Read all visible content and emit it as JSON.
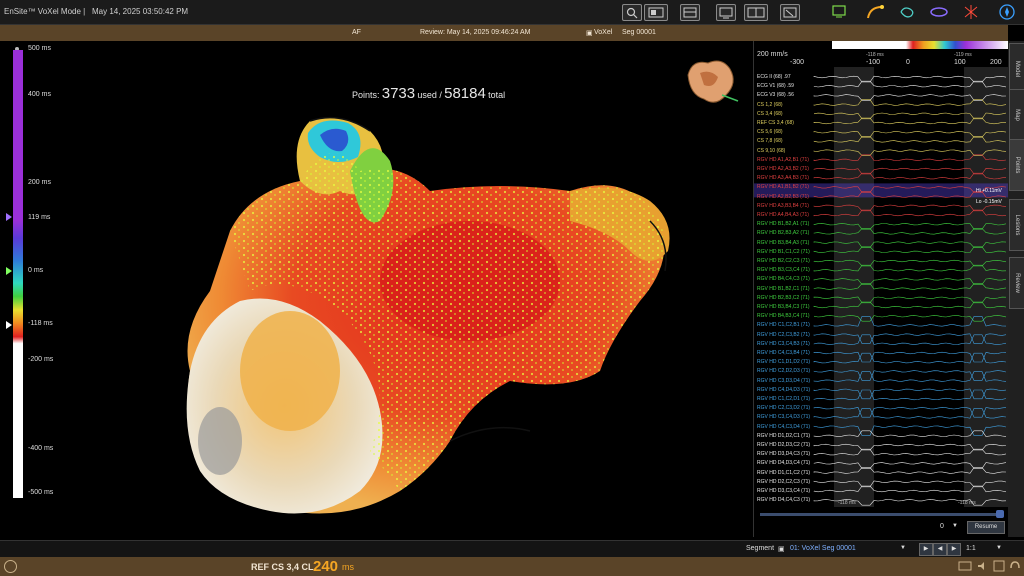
{
  "titlebar": {
    "app_title": "EnSite™ VoXel Mode |",
    "datetime": "May 14, 2025 03:50:42 PM"
  },
  "infobar": {
    "rhythm": "AF",
    "review": "Review: May 14, 2025 09:46:24 AM",
    "mode": "VoXel",
    "segment": "Seg 00001"
  },
  "map": {
    "points_label": "Points:",
    "points_used": "3733",
    "used_label": "used /",
    "points_total": "58184",
    "total_label": "total"
  },
  "scale": {
    "ticks": [
      "500 ms",
      "400 ms",
      "200 ms",
      "119 ms",
      "0 ms",
      "-118 ms",
      "-200 ms",
      "-400 ms",
      "-500 ms"
    ]
  },
  "egm": {
    "sweep": "200 mm/s",
    "time_ticks": [
      "-300",
      "-100",
      "0",
      "100",
      "200"
    ],
    "marker_a": "-118 ms",
    "marker_b": "-119 ms",
    "value_hi": "Hi +0.11mV",
    "value_lo": "Lo -0.15mV",
    "page_value": "0",
    "resume_label": "Resume",
    "foot_a": "-118 ms",
    "foot_b": "-118 ms",
    "channels": [
      "ECG II (68) .97",
      "ECG V1 (68) .59",
      "ECG V3 (68) .56",
      "CS 1,2 (68)",
      "CS 3,4 (68)",
      "REF CS 3,4 (68)",
      "CS 5,6 (68)",
      "CS 7,8 (68)",
      "CS 9,10 (68)",
      "RGV HD  A1,A2,B1 (71)",
      "RGV HD  A2,A3,B2 (71)",
      "RGV HD  A3,A4,B3 (71)",
      "RGV HD  A1,B1,B2 (71)",
      "RGV HD  A2,B2,B3 (71)",
      "RGV HD  A3,B3,B4 (71)",
      "RGV HD  A4,B4,A3 (71)",
      "RGV HD  B1,B2,A1 (71)",
      "RGV HD  B2,B3,A2 (71)",
      "RGV HD  B3,B4,A3 (71)",
      "RGV HD  B1,C1,C2 (71)",
      "RGV HD  B2,C2,C3 (71)",
      "RGV HD  B3,C3,C4 (71)",
      "RGV HD  B4,C4,C3 (71)",
      "RGV HD  B1,B2,C1 (71)",
      "RGV HD  B2,B3,C2 (71)",
      "RGV HD  B3,B4,C3 (71)",
      "RGV HD  B4,B3,C4 (71)",
      "RGV HD  C1,C2,B1 (71)",
      "RGV HD  C2,C3,B2 (71)",
      "RGV HD  C3,C4,B3 (71)",
      "RGV HD  C4,C3,B4 (71)",
      "RGV HD  C1,D1,D2 (71)",
      "RGV HD  C2,D2,D3 (71)",
      "RGV HD  C3,D3,D4 (71)",
      "RGV HD  C4,D4,D3 (71)",
      "RGV HD  C1,C2,D1 (71)",
      "RGV HD  C2,C3,D2 (71)",
      "RGV HD  C3,C4,D3 (71)",
      "RGV HD  C4,C3,D4 (71)",
      "RGV HD  D1,D2,C1 (71)",
      "RGV HD  D2,D3,C2 (71)",
      "RGV HD  D3,D4,C3 (71)",
      "RGV HD  D4,D3,C4 (71)",
      "RGV HD  D1,C1,C2 (71)",
      "RGV HD  D2,C2,C3 (71)",
      "RGV HD  D3,C3,C4 (71)",
      "RGV HD  D4,C4,C3 (71)"
    ]
  },
  "sidetabs": [
    "Model",
    "Map",
    "Points",
    "Lesions",
    "Review"
  ],
  "segbar": {
    "label": "Segment",
    "value": "01: VoXel Seg 00001",
    "rate": "1:1"
  },
  "status": {
    "ref": "REF CS 3,4 CL",
    "cl_value": "240",
    "cl_unit": "ms"
  },
  "colors": {
    "accent": "#f5a623",
    "brown": "#5a4428",
    "purple": "#9b30d9"
  },
  "icons": [
    "search-icon",
    "screen-icon",
    "layout-icon",
    "monitor-icon",
    "catheter-icon",
    "heart-icon",
    "ablation-icon",
    "spark-icon",
    "compass-icon"
  ]
}
